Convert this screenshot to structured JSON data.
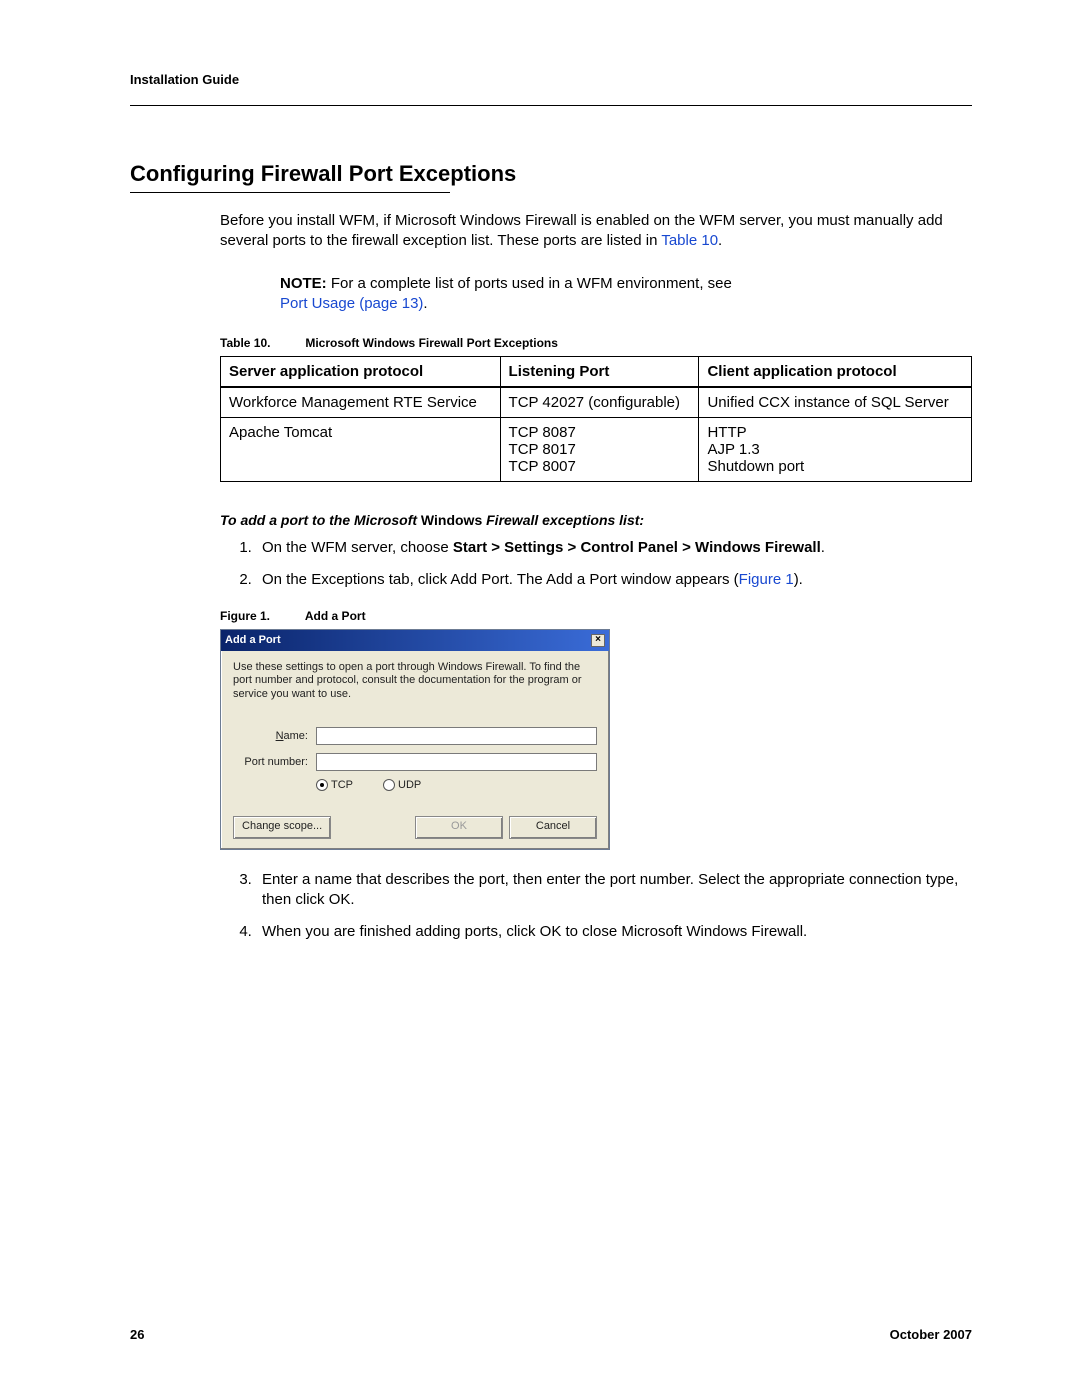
{
  "header": {
    "title": "Installation Guide"
  },
  "section": {
    "heading": "Configuring Firewall Port Exceptions"
  },
  "intro": {
    "text": "Before you install WFM, if Microsoft Windows Firewall is enabled on the WFM server, you must manually add several ports to the firewall exception list. These ports are listed in ",
    "ref": "Table 10",
    "tail": "."
  },
  "note": {
    "label": "NOTE:",
    "text": "For a complete list of ports used in a WFM environment, see ",
    "ref": "Port Usage (page 13)",
    "tail": "."
  },
  "table": {
    "caption_label": "Table 10.",
    "caption_text": "Microsoft Windows Firewall Port Exceptions",
    "headers": [
      "Server application protocol",
      "Listening Port",
      "Client application protocol"
    ],
    "rows": [
      {
        "c0": "Workforce Management RTE Service",
        "c1": "TCP 42027 (configurable)",
        "c2": "Unified CCX instance of SQL Server"
      },
      {
        "c0": "Apache Tomcat",
        "c1": "TCP 8087\nTCP 8017\nTCP 8007",
        "c2": "HTTP\nAJP 1.3\nShutdown port"
      }
    ]
  },
  "procedure": {
    "title_pre": "To add a port to the Microsoft ",
    "title_bold": "Windows",
    "title_post": " Firewall exceptions list:",
    "steps": {
      "s1_pre": "On the WFM server, choose ",
      "s1_bold": "Start > Settings > Control Panel > Windows Firewall",
      "s1_post": ".",
      "s2_pre": "On the Exceptions tab, click Add Port. The Add a Port window appears (",
      "s2_ref": "Figure 1",
      "s2_post": ").",
      "s3": "Enter a name that describes the port, then enter the port number. Select the appropriate connection type, then click OK.",
      "s4": "When you are finished adding ports, click OK to close Microsoft Windows Firewall."
    }
  },
  "figure": {
    "caption_label": "Figure 1.",
    "caption_text": "Add a Port"
  },
  "dialog": {
    "title": "Add a Port",
    "desc": "Use these settings to open a port through Windows Firewall. To find the port number and protocol, consult the documentation for the program or service you want to use.",
    "name_label": "Name:",
    "port_label": "Port number:",
    "tcp": "TCP",
    "udp": "UDP",
    "change_scope": "Change scope...",
    "ok": "OK",
    "cancel": "Cancel"
  },
  "footer": {
    "page": "26",
    "date": "October 2007"
  }
}
